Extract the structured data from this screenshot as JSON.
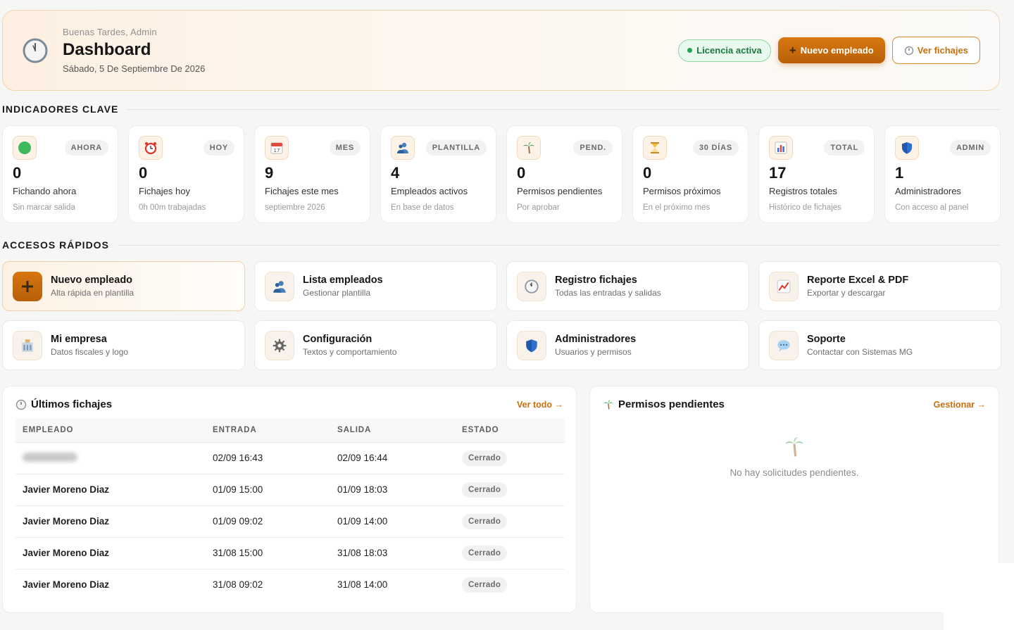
{
  "header": {
    "greeting": "Buenas Tardes, Admin",
    "title": "Dashboard",
    "date": "Sábado, 5 De Septiembre De 2026",
    "license_badge": "Licencia activa",
    "new_employee_button": "Nuevo empleado",
    "view_clockings_button": "Ver fichajes"
  },
  "sections": {
    "kpis": "INDICADORES CLAVE",
    "quick_access": "ACCESOS RÁPIDOS"
  },
  "kpis": [
    {
      "tag": "AHORA",
      "value": "0",
      "label": "Fichando ahora",
      "sub": "Sin marcar salida",
      "icon": "green-circle-icon"
    },
    {
      "tag": "HOY",
      "value": "0",
      "label": "Fichajes hoy",
      "sub": "0h 00m trabajadas",
      "icon": "alarm-clock-icon"
    },
    {
      "tag": "MES",
      "value": "9",
      "label": "Fichajes este mes",
      "sub": "septiembre 2026",
      "icon": "calendar-icon"
    },
    {
      "tag": "PLANTILLA",
      "value": "4",
      "label": "Empleados activos",
      "sub": "En base de datos",
      "icon": "people-icon"
    },
    {
      "tag": "PEND.",
      "value": "0",
      "label": "Permisos pendientes",
      "sub": "Por aprobar",
      "icon": "palm-tree-icon"
    },
    {
      "tag": "30 DÍAS",
      "value": "0",
      "label": "Permisos próximos",
      "sub": "En el próximo mes",
      "icon": "hourglass-icon"
    },
    {
      "tag": "TOTAL",
      "value": "17",
      "label": "Registros totales",
      "sub": "Histórico de fichajes",
      "icon": "bar-chart-icon"
    },
    {
      "tag": "ADMIN",
      "value": "1",
      "label": "Administradores",
      "sub": "Con acceso al panel",
      "icon": "shield-icon"
    }
  ],
  "quick_access": [
    {
      "title": "Nuevo empleado",
      "sub": "Alta rápida en plantilla",
      "icon": "plus-icon"
    },
    {
      "title": "Lista empleados",
      "sub": "Gestionar plantilla",
      "icon": "people-icon"
    },
    {
      "title": "Registro fichajes",
      "sub": "Todas las entradas y salidas",
      "icon": "clock-icon"
    },
    {
      "title": "Reporte Excel & PDF",
      "sub": "Exportar y descargar",
      "icon": "trend-chart-icon"
    },
    {
      "title": "Mi empresa",
      "sub": "Datos fiscales y logo",
      "icon": "building-icon"
    },
    {
      "title": "Configuración",
      "sub": "Textos y comportamiento",
      "icon": "gear-icon"
    },
    {
      "title": "Administradores",
      "sub": "Usuarios y permisos",
      "icon": "shield-icon"
    },
    {
      "title": "Soporte",
      "sub": "Contactar con Sistemas MG",
      "icon": "chat-bubble-icon"
    }
  ],
  "recent_clockings": {
    "title": "Últimos fichajes",
    "link": "Ver todo →",
    "columns": [
      "EMPLEADO",
      "ENTRADA",
      "SALIDA",
      "ESTADO"
    ],
    "rows": [
      {
        "employee": "",
        "blurred": true,
        "entry": "02/09 16:43",
        "exit": "02/09 16:44",
        "status": "Cerrado"
      },
      {
        "employee": "Javier Moreno Diaz",
        "blurred": false,
        "entry": "01/09 15:00",
        "exit": "01/09 18:03",
        "status": "Cerrado"
      },
      {
        "employee": "Javier Moreno Diaz",
        "blurred": false,
        "entry": "01/09 09:02",
        "exit": "01/09 14:00",
        "status": "Cerrado"
      },
      {
        "employee": "Javier Moreno Diaz",
        "blurred": false,
        "entry": "31/08 15:00",
        "exit": "31/08 18:03",
        "status": "Cerrado"
      },
      {
        "employee": "Javier Moreno Diaz",
        "blurred": false,
        "entry": "31/08 09:02",
        "exit": "31/08 14:00",
        "status": "Cerrado"
      }
    ]
  },
  "pending_permissions": {
    "title": "Permisos pendientes",
    "link": "Gestionar →",
    "empty_text": "No hay solicitudes pendientes."
  },
  "colors": {
    "accent": "#c8700f",
    "license_green": "#1b7a3c",
    "page_bg": "#f6f6f5"
  }
}
